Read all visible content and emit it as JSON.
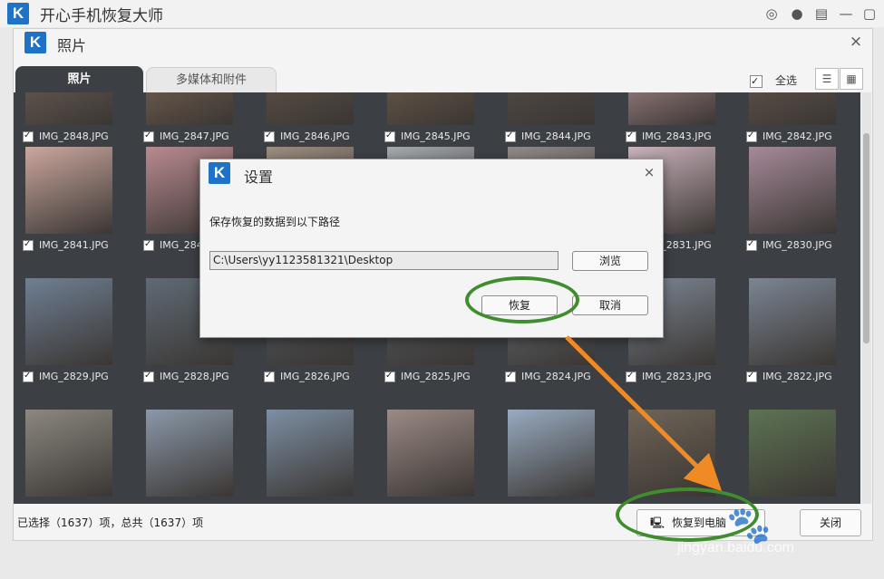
{
  "app": {
    "title": "开心手机恢复大师",
    "logo_letter": "K"
  },
  "window": {
    "title": "照片",
    "close_glyph": "×"
  },
  "tabs": [
    {
      "label": "照片"
    },
    {
      "label": "多媒体和附件"
    }
  ],
  "toolbar": {
    "select_all_label": "全选"
  },
  "photos": [
    {
      "name": "IMG_2848.JPG",
      "color": "#7a6a60"
    },
    {
      "name": "IMG_2847.JPG",
      "color": "#8a6f5c"
    },
    {
      "name": "IMG_2846.JPG",
      "color": "#6b5b4e"
    },
    {
      "name": "IMG_2845.JPG",
      "color": "#7c6652"
    },
    {
      "name": "IMG_2844.JPG",
      "color": "#5c5550"
    },
    {
      "name": "IMG_2843.JPG",
      "color": "#c9a0a6"
    },
    {
      "name": "IMG_2842.JPG",
      "color": "#705e55"
    },
    {
      "name": "IMG_2841.JPG",
      "color": "#caa79e"
    },
    {
      "name": "IMG_2840.JPG",
      "color": "#b98a90"
    },
    {
      "name": "",
      "color": "#9c8d80"
    },
    {
      "name": "",
      "color": "#a4a9ad"
    },
    {
      "name": "",
      "color": "#8f8a88"
    },
    {
      "name": "IMG_2831.JPG",
      "color": "#c9b2bb"
    },
    {
      "name": "IMG_2830.JPG",
      "color": "#a58a99"
    },
    {
      "name": "IMG_2829.JPG",
      "color": "#6f7f93"
    },
    {
      "name": "IMG_2828.JPG",
      "color": "#5f6a75"
    },
    {
      "name": "IMG_2826.JPG",
      "color": "#555d66"
    },
    {
      "name": "IMG_2825.JPG",
      "color": "#5a6068"
    },
    {
      "name": "IMG_2824.JPG",
      "color": "#6b727a"
    },
    {
      "name": "IMG_2823.JPG",
      "color": "#7d8794"
    },
    {
      "name": "IMG_2822.JPG",
      "color": "#7b8593"
    },
    {
      "name": "",
      "color": "#8c8880"
    },
    {
      "name": "",
      "color": "#8a98a8"
    },
    {
      "name": "",
      "color": "#7d8fa3"
    },
    {
      "name": "",
      "color": "#9b8a85"
    },
    {
      "name": "",
      "color": "#98abc0"
    },
    {
      "name": "",
      "color": "#6f6457"
    },
    {
      "name": "",
      "color": "#5d7353"
    }
  ],
  "status": {
    "text": "已选择（1637）项，总共（1637）项"
  },
  "actions": {
    "export_label": "恢复到电脑",
    "close_label": "关闭"
  },
  "dialog": {
    "title": "设置",
    "prompt": "保存恢复的数据到以下路径",
    "path": "C:\\Users\\yy1123581321\\Desktop",
    "browse_label": "浏览",
    "recover_label": "恢复",
    "cancel_label": "取消",
    "close_glyph": "×"
  },
  "watermark": {
    "text": "jingyan.baidu.com"
  },
  "colors": {
    "accent": "#1e73c6",
    "annotation_green": "#3f8d2f",
    "annotation_orange": "#f08a24",
    "grid_bg": "#3c3f44"
  }
}
